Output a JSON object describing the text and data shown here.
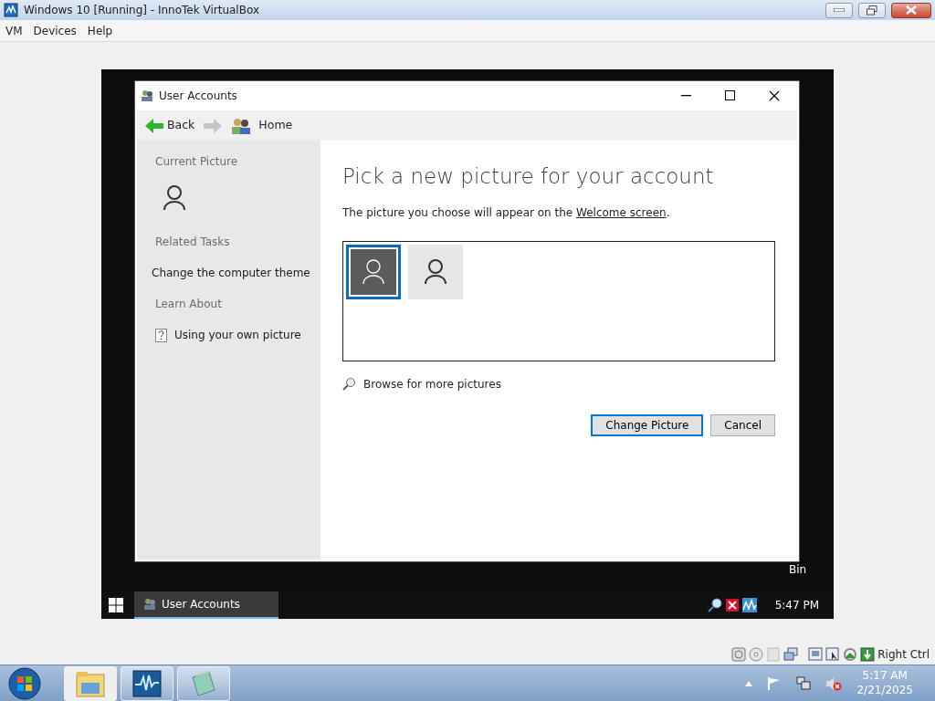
{
  "host_window": {
    "title": "Windows 10 [Running] - InnoTek VirtualBox"
  },
  "menu": [
    {
      "label": "VM"
    },
    {
      "label": "Devices"
    },
    {
      "label": "Help"
    }
  ],
  "guest": {
    "desktop_icons": [
      {
        "label": "Bin"
      }
    ],
    "window": {
      "title": "User Accounts",
      "nav": {
        "back": "Back",
        "home": "Home"
      },
      "sidebar": {
        "current_title": "Current Picture",
        "related_title": "Related Tasks",
        "related": [
          {
            "label": "Change the computer theme"
          }
        ],
        "learn_title": "Learn About",
        "learn": [
          {
            "label": "Using your own picture"
          }
        ]
      },
      "heading": "Pick a new picture for your account",
      "description": {
        "text": "The picture you choose will appear on the ",
        "link": "Welcome screen",
        "end": "."
      },
      "pictures": [
        {
          "selected": true
        },
        {
          "selected": false
        }
      ],
      "browse": "Browse for more pictures",
      "buttons": [
        {
          "label": "Change Picture",
          "default": true
        },
        {
          "label": "Cancel",
          "default": false
        }
      ]
    },
    "taskbar": {
      "items": [
        {
          "label": "User Accounts",
          "active": true
        }
      ],
      "time": "5:47 PM"
    }
  },
  "host_status": {
    "key": "Right Ctrl"
  },
  "host_taskbar": {
    "items": [
      {
        "kind": "folder",
        "running": false
      },
      {
        "kind": "monitor",
        "running": true
      },
      {
        "kind": "notepad",
        "running": true
      }
    ],
    "time": "5:17 AM",
    "date": "2/21/2025"
  }
}
